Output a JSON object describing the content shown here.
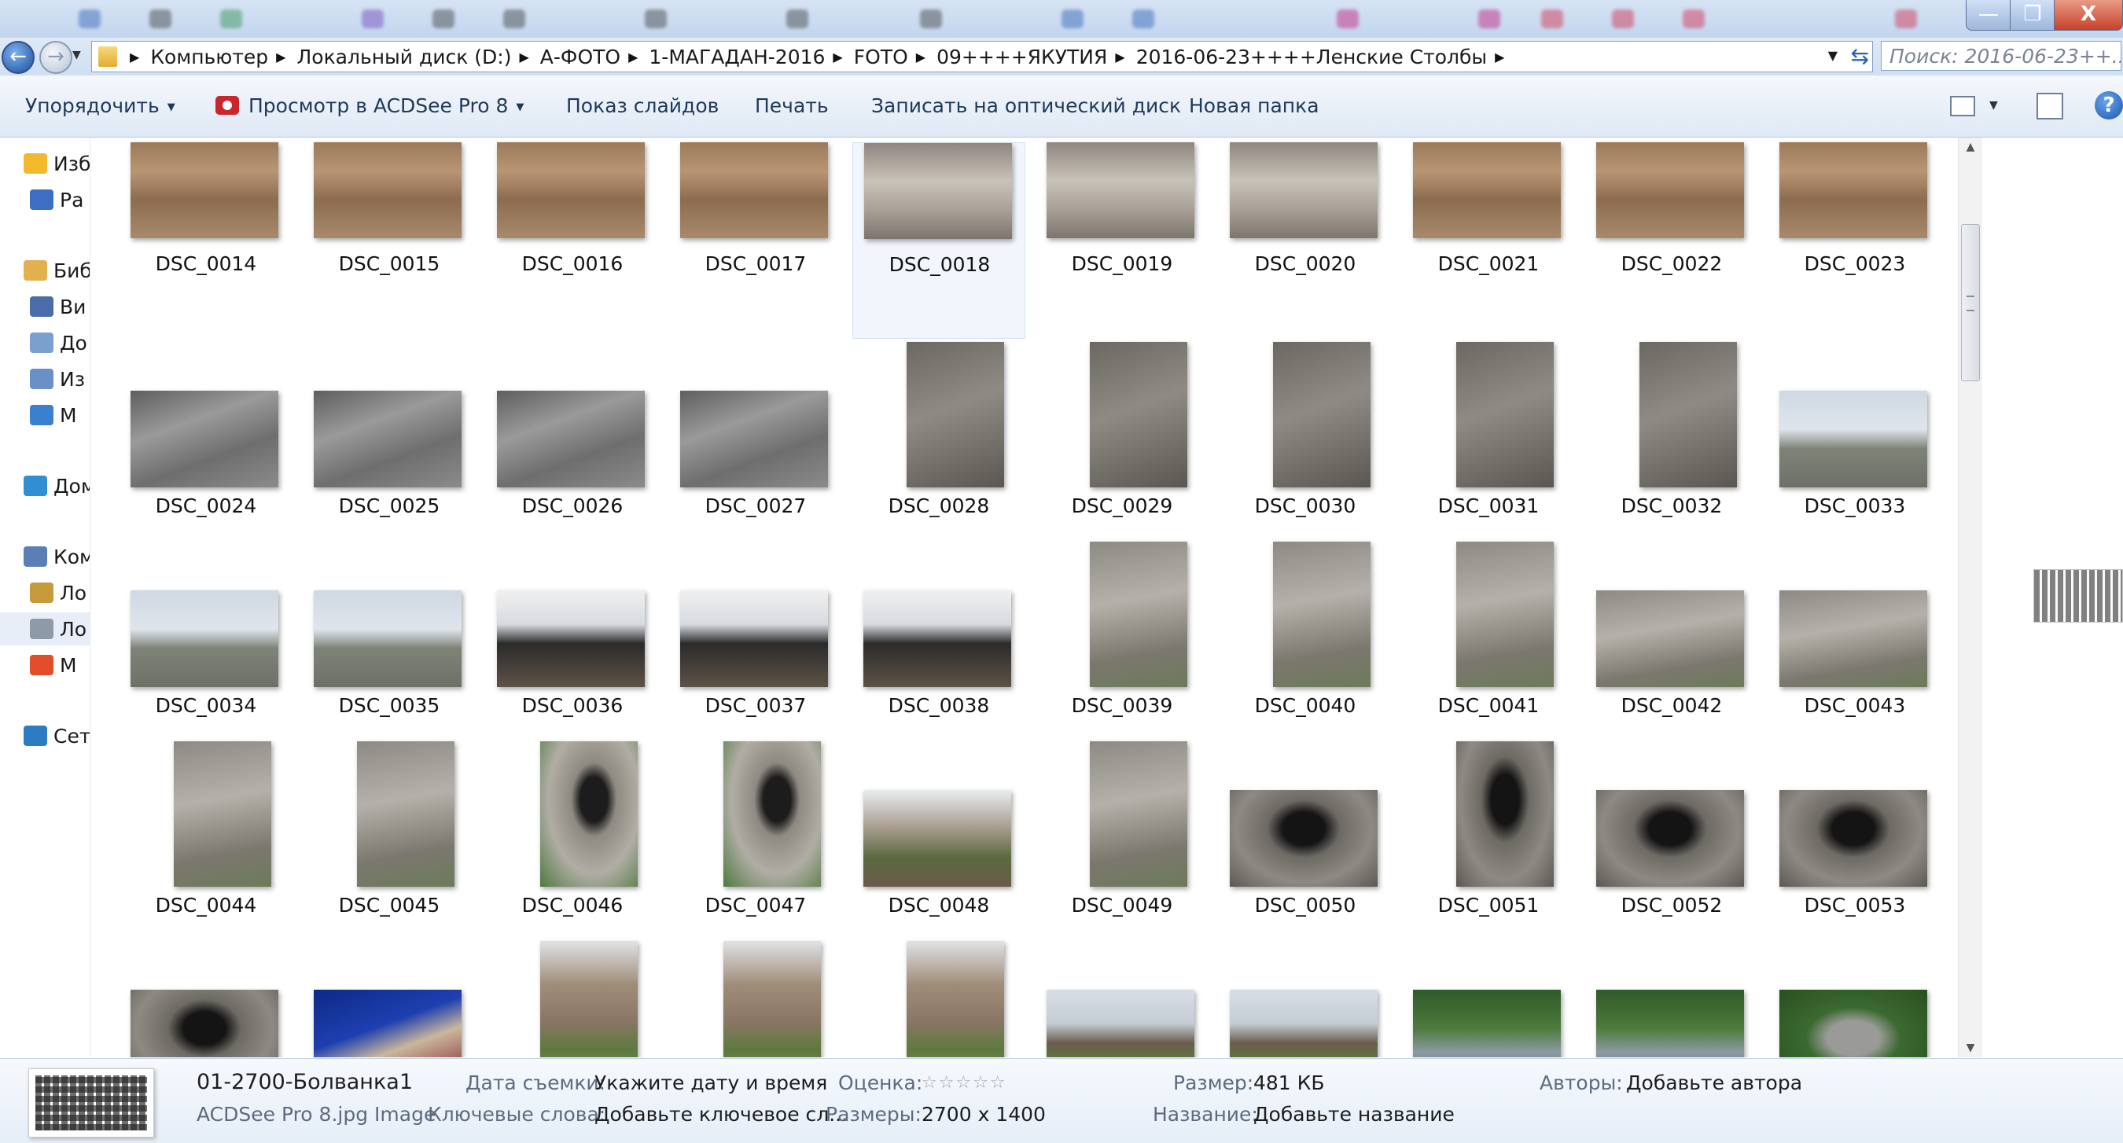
{
  "window": {
    "controls": {
      "minimize": "—",
      "maximize": "❐",
      "close": "X"
    }
  },
  "address_bar": {
    "breadcrumbs": [
      "Компьютер",
      "Локальный диск (D:)",
      "А-ФОТО",
      "1-МАГАДАН-2016",
      "FOTO",
      "09++++ЯКУТИЯ",
      "2016-06-23++++Ленские Столбы"
    ],
    "search_placeholder": "Поиск: 2016-06-23++..."
  },
  "toolbar": {
    "organize": "Упорядочить",
    "view_in_acdsee": "Просмотр в ACDSee Pro 8",
    "slideshow": "Показ слайдов",
    "print": "Печать",
    "burn": "Записать на оптический диск",
    "new_folder": "Новая папка",
    "help": "?"
  },
  "nav_pane": {
    "items": [
      {
        "label": "Изб",
        "icon": "star-icon",
        "color": "#f2b92f"
      },
      {
        "label": "Ра",
        "icon": "desktop-icon",
        "color": "#3b6fc4"
      },
      {
        "label": "Биб",
        "icon": "library-icon",
        "color": "#e2b04d"
      },
      {
        "label": "Ви",
        "icon": "video-icon",
        "color": "#4a6ca8"
      },
      {
        "label": "До",
        "icon": "documents-icon",
        "color": "#7aa0cf"
      },
      {
        "label": "Из",
        "icon": "pictures-icon",
        "color": "#6b8fc7"
      },
      {
        "label": "М",
        "icon": "music-icon",
        "color": "#3b7fd0"
      },
      {
        "label": "Дом",
        "icon": "homegroup-icon",
        "color": "#2f8fd2"
      },
      {
        "label": "Ком",
        "icon": "computer-icon",
        "color": "#5a7fb6"
      },
      {
        "label": "Ло",
        "icon": "drive-icon",
        "color": "#c79a3c"
      },
      {
        "label": "Ло",
        "icon": "drive-icon",
        "color": "#8e9aa8"
      },
      {
        "label": "М",
        "icon": "media-icon",
        "color": "#e24d2c"
      },
      {
        "label": "Сет",
        "icon": "network-icon",
        "color": "#2d7cc3"
      }
    ]
  },
  "files": [
    {
      "name": "DSC_0014",
      "orient": "land",
      "kind": "rock-art"
    },
    {
      "name": "DSC_0015",
      "orient": "land",
      "kind": "rock-art"
    },
    {
      "name": "DSC_0016",
      "orient": "land",
      "kind": "rock-art"
    },
    {
      "name": "DSC_0017",
      "orient": "land",
      "kind": "rock-art"
    },
    {
      "name": "DSC_0018",
      "orient": "land",
      "kind": "rock-pale",
      "selected": true
    },
    {
      "name": "DSC_0019",
      "orient": "land",
      "kind": "rock-pale"
    },
    {
      "name": "DSC_0020",
      "orient": "land",
      "kind": "rock-pale"
    },
    {
      "name": "DSC_0021",
      "orient": "land",
      "kind": "rock-art"
    },
    {
      "name": "DSC_0022",
      "orient": "land",
      "kind": "rock-art"
    },
    {
      "name": "DSC_0023",
      "orient": "land",
      "kind": "rock-art"
    },
    {
      "name": "DSC_0024",
      "orient": "land",
      "kind": "rock-gray"
    },
    {
      "name": "DSC_0025",
      "orient": "land",
      "kind": "rock-gray"
    },
    {
      "name": "DSC_0026",
      "orient": "land",
      "kind": "rock-gray"
    },
    {
      "name": "DSC_0027",
      "orient": "land",
      "kind": "rock-gray"
    },
    {
      "name": "DSC_0028",
      "orient": "port",
      "kind": "person-rock"
    },
    {
      "name": "DSC_0029",
      "orient": "port",
      "kind": "person-rock"
    },
    {
      "name": "DSC_0030",
      "orient": "port",
      "kind": "person-rock"
    },
    {
      "name": "DSC_0031",
      "orient": "port",
      "kind": "person-rock"
    },
    {
      "name": "DSC_0032",
      "orient": "port",
      "kind": "person-rock"
    },
    {
      "name": "DSC_0033",
      "orient": "land",
      "kind": "group-beach"
    },
    {
      "name": "DSC_0034",
      "orient": "land",
      "kind": "group-beach"
    },
    {
      "name": "DSC_0035",
      "orient": "land",
      "kind": "group-beach"
    },
    {
      "name": "DSC_0036",
      "orient": "land",
      "kind": "boat"
    },
    {
      "name": "DSC_0037",
      "orient": "land",
      "kind": "boat"
    },
    {
      "name": "DSC_0038",
      "orient": "land",
      "kind": "boat"
    },
    {
      "name": "DSC_0039",
      "orient": "port",
      "kind": "rock-climb"
    },
    {
      "name": "DSC_0040",
      "orient": "port",
      "kind": "rock-climb"
    },
    {
      "name": "DSC_0041",
      "orient": "port",
      "kind": "rock-climb"
    },
    {
      "name": "DSC_0042",
      "orient": "land",
      "kind": "rock-climb"
    },
    {
      "name": "DSC_0043",
      "orient": "land",
      "kind": "rock-climb"
    },
    {
      "name": "DSC_0044",
      "orient": "port",
      "kind": "rock-climb"
    },
    {
      "name": "DSC_0045",
      "orient": "port",
      "kind": "rock-climb"
    },
    {
      "name": "DSC_0046",
      "orient": "port",
      "kind": "cave-green"
    },
    {
      "name": "DSC_0047",
      "orient": "port",
      "kind": "cave-green"
    },
    {
      "name": "DSC_0048",
      "orient": "land",
      "kind": "forest-rock"
    },
    {
      "name": "DSC_0049",
      "orient": "port",
      "kind": "rock-climb"
    },
    {
      "name": "DSC_0050",
      "orient": "land",
      "kind": "cave"
    },
    {
      "name": "DSC_0051",
      "orient": "port",
      "kind": "cave"
    },
    {
      "name": "DSC_0052",
      "orient": "land",
      "kind": "cave"
    },
    {
      "name": "DSC_0053",
      "orient": "land",
      "kind": "cave"
    },
    {
      "name": "",
      "orient": "land",
      "kind": "cave"
    },
    {
      "name": "",
      "orient": "land",
      "kind": "portrait-blue"
    },
    {
      "name": "",
      "orient": "port",
      "kind": "pillar"
    },
    {
      "name": "",
      "orient": "port",
      "kind": "pillar"
    },
    {
      "name": "",
      "orient": "port",
      "kind": "pillar"
    },
    {
      "name": "",
      "orient": "land",
      "kind": "river-cliff"
    },
    {
      "name": "",
      "orient": "land",
      "kind": "river-cliff"
    },
    {
      "name": "",
      "orient": "land",
      "kind": "forest-people"
    },
    {
      "name": "",
      "orient": "land",
      "kind": "forest-people"
    },
    {
      "name": "",
      "orient": "land",
      "kind": "totem"
    }
  ],
  "details": {
    "filename": "01-2700-Болванка1",
    "filetype": "ACDSee Pro 8.jpg Image",
    "date_label": "Дата съемки:",
    "date_value": "Укажите дату и время",
    "keywords_label": "Ключевые слова:",
    "keywords_value": "Добавьте ключевое сл...",
    "rating_label": "Оценка:",
    "rating_value": "☆☆☆☆☆",
    "dimensions_label": "Размеры:",
    "dimensions_value": "2700 x 1400",
    "size_label": "Размер:",
    "size_value": "481 КБ",
    "title_label": "Название:",
    "title_value": "Добавьте название",
    "authors_label": "Авторы:",
    "authors_value": "Добавьте автора"
  }
}
